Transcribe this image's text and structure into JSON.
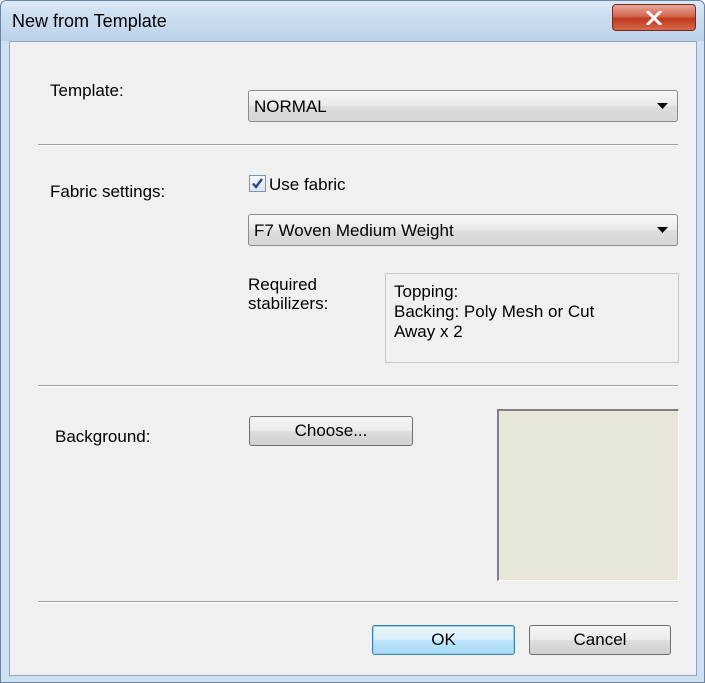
{
  "window": {
    "title": "New from Template",
    "close_glyph": "close-icon"
  },
  "template": {
    "label": "Template:",
    "selected": "NORMAL"
  },
  "fabric": {
    "label": "Fabric settings:",
    "use_fabric_label": "Use fabric",
    "use_fabric_checked": true,
    "selected": "F7 Woven Medium Weight",
    "stabilizers_label": "Required\nstabilizers:",
    "stabilizers_text": "Topping:\nBacking: Poly Mesh or Cut\nAway x 2"
  },
  "background": {
    "label": "Background:",
    "choose_label": "Choose...",
    "swatch_color": "#e8e6d8"
  },
  "footer": {
    "ok_label": "OK",
    "cancel_label": "Cancel"
  }
}
